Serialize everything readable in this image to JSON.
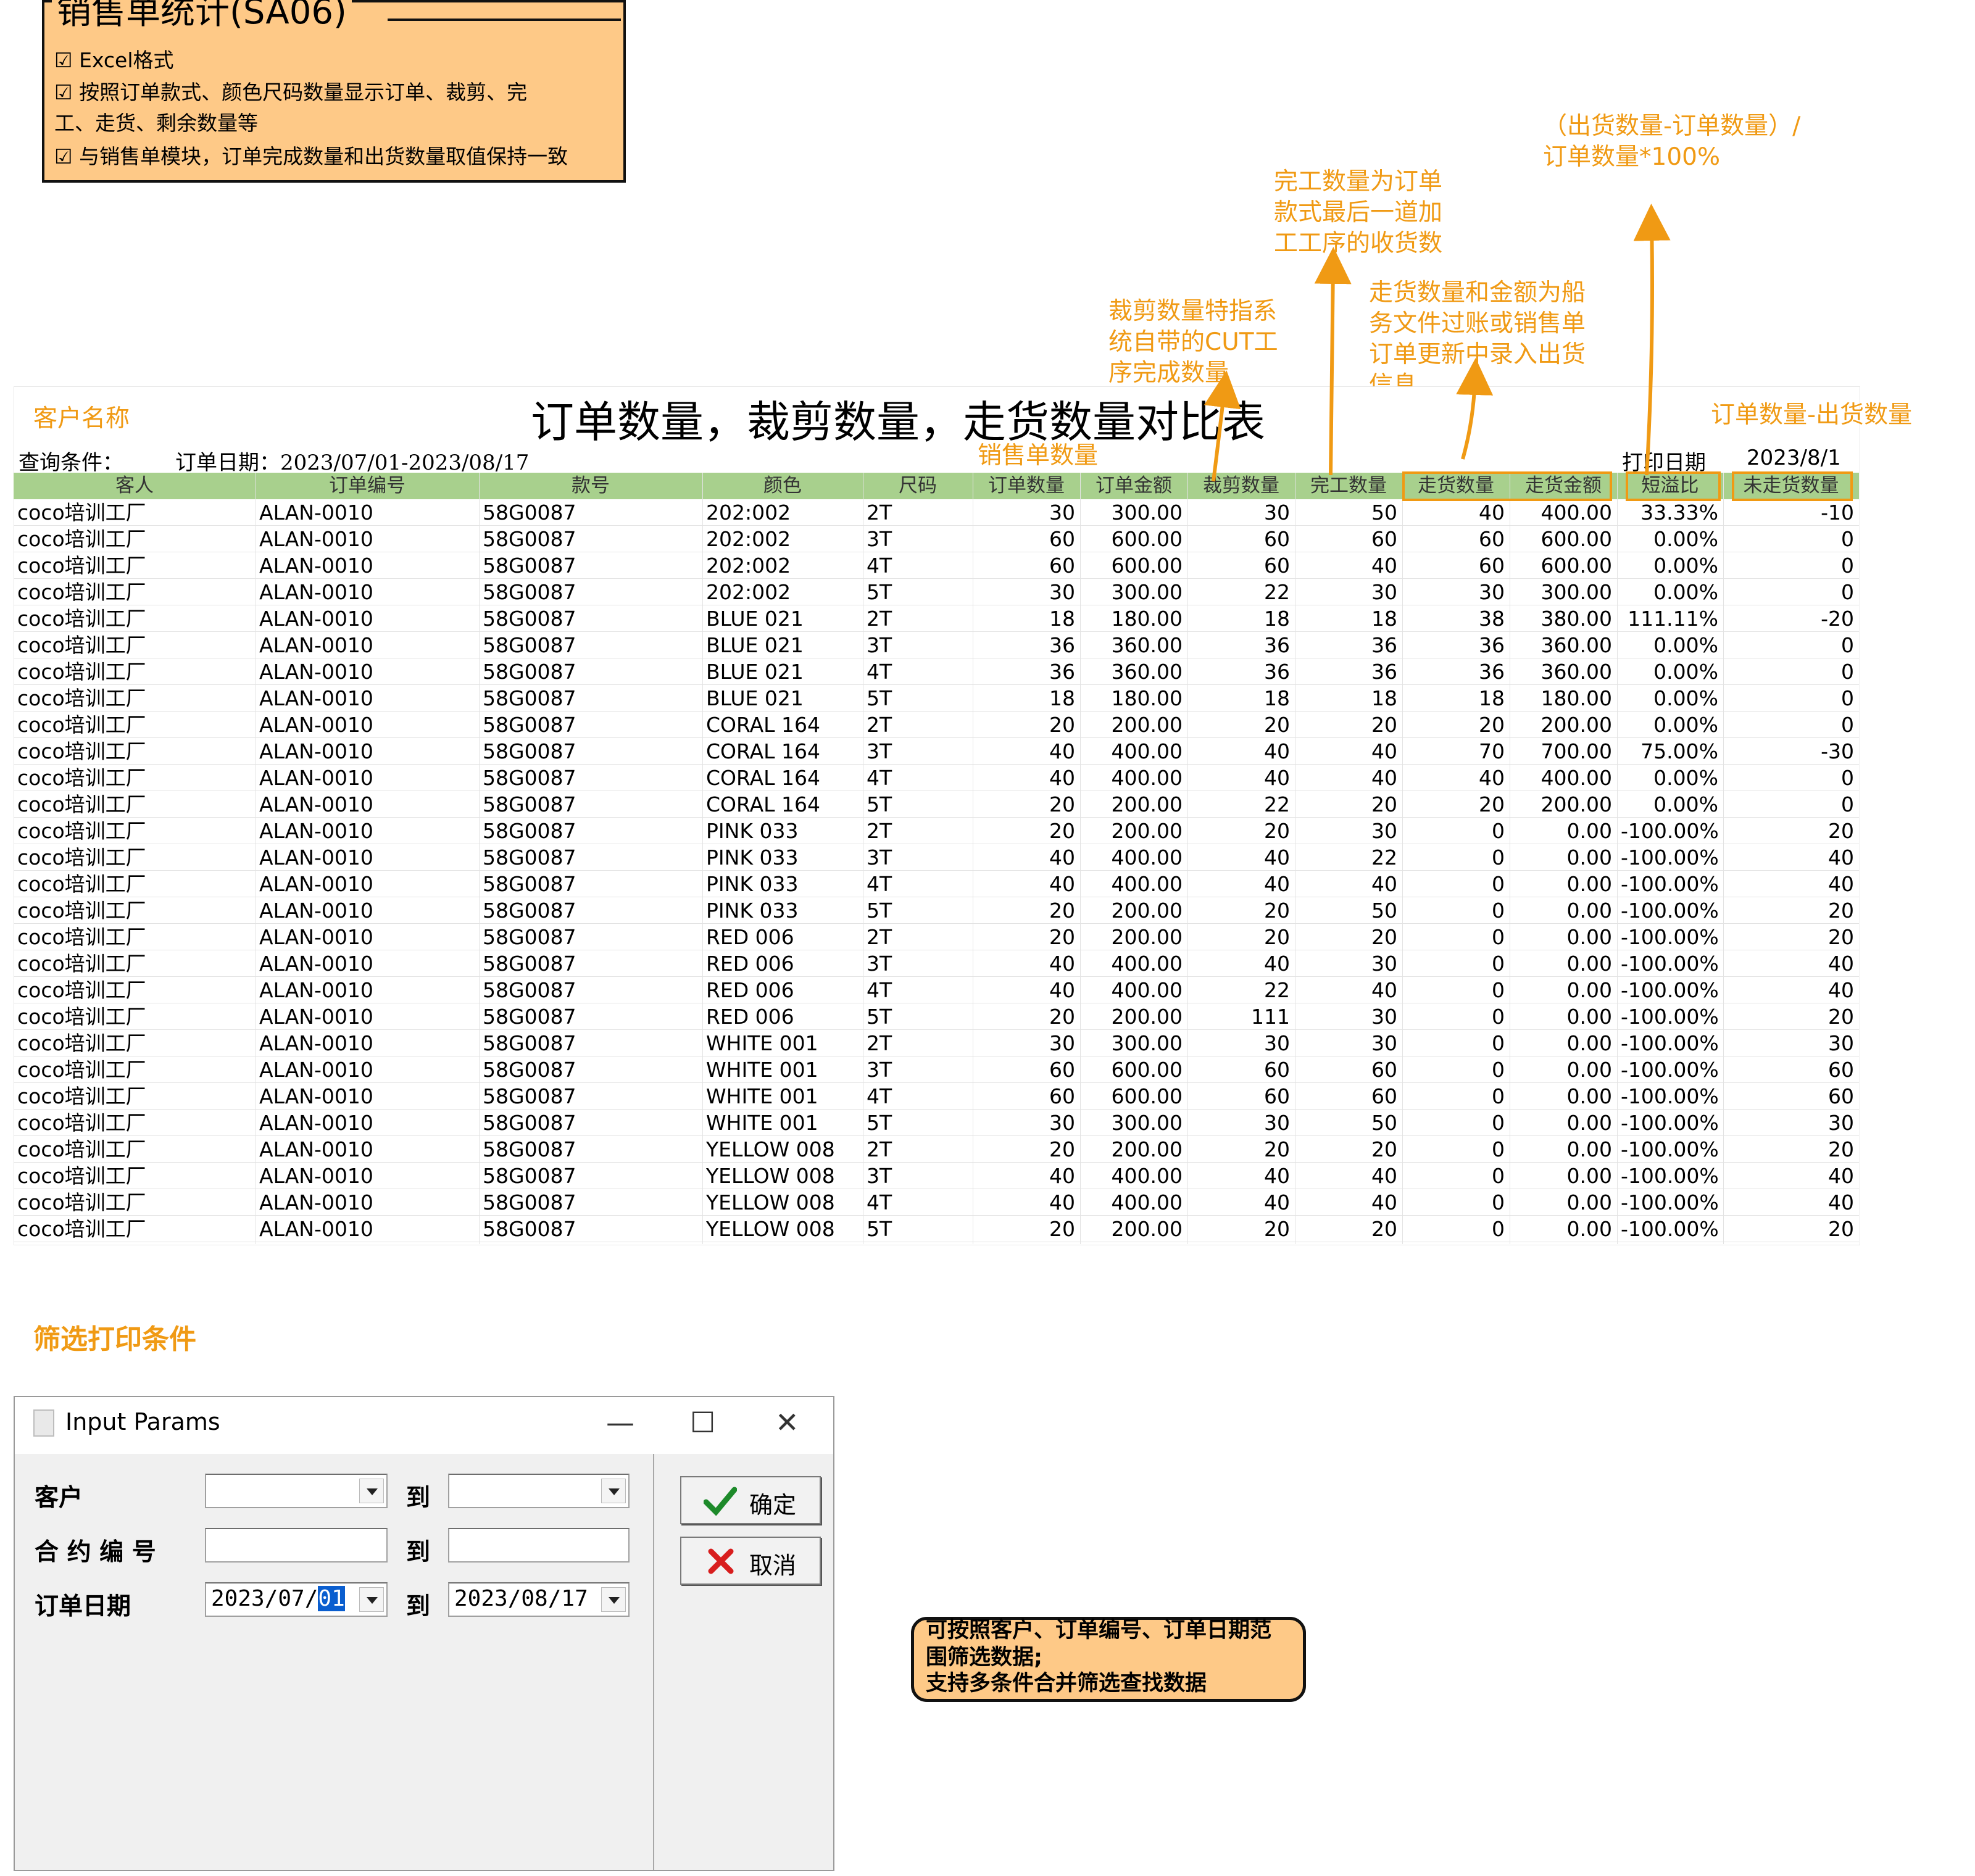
{
  "note": {
    "title": "销售单统计(SA06)",
    "lines": [
      "☑ Excel格式",
      "☑ 按照订单款式、颜色尺码数量显示订单、裁剪、完",
      "工、走货、剩余数量等",
      "☑ 与销售单模块，订单完成数量和出货数量取值保持一致"
    ]
  },
  "annotations": {
    "ratio_formula": [
      "（出货数量-订单数量）/",
      "订单数量*100%"
    ],
    "finish_qty": [
      "完工数量为订单",
      "款式最后一道加",
      "工工序的收货数"
    ],
    "ship_qty": [
      "走货数量和金额为船",
      "务文件过账或销售单",
      "订单更新中录入出货",
      "信息"
    ],
    "cut_qty": [
      "裁剪数量特指系",
      "统自带的CUT工",
      "序完成数量"
    ],
    "customer_name": "客户名称",
    "unshipped": "订单数量-出货数量",
    "sales_qty": "销售单数量",
    "filter_title": "筛选打印条件"
  },
  "report": {
    "title": "订单数量，裁剪数量，走货数量对比表",
    "condition_label": "查询条件：",
    "condition_value": "订单日期：2023/07/01-2023/08/17",
    "print_date_label": "打印日期",
    "print_date_value": "2023/8/1",
    "headers": [
      "客人",
      "订单编号",
      "款号",
      "颜色",
      "尺码",
      "订单数量",
      "订单金额",
      "裁剪数量",
      "完工数量",
      "走货数量",
      "走货金额",
      "短溢比",
      "未走货数量"
    ],
    "rows": [
      [
        "coco培训工厂",
        "ALAN-0010",
        "58G0087",
        "202:002",
        "2T",
        "30",
        "300.00",
        "30",
        "50",
        "40",
        "400.00",
        "33.33%",
        "-10"
      ],
      [
        "coco培训工厂",
        "ALAN-0010",
        "58G0087",
        "202:002",
        "3T",
        "60",
        "600.00",
        "60",
        "60",
        "60",
        "600.00",
        "0.00%",
        "0"
      ],
      [
        "coco培训工厂",
        "ALAN-0010",
        "58G0087",
        "202:002",
        "4T",
        "60",
        "600.00",
        "60",
        "40",
        "60",
        "600.00",
        "0.00%",
        "0"
      ],
      [
        "coco培训工厂",
        "ALAN-0010",
        "58G0087",
        "202:002",
        "5T",
        "30",
        "300.00",
        "22",
        "30",
        "30",
        "300.00",
        "0.00%",
        "0"
      ],
      [
        "coco培训工厂",
        "ALAN-0010",
        "58G0087",
        "BLUE 021",
        "2T",
        "18",
        "180.00",
        "18",
        "18",
        "38",
        "380.00",
        "111.11%",
        "-20"
      ],
      [
        "coco培训工厂",
        "ALAN-0010",
        "58G0087",
        "BLUE 021",
        "3T",
        "36",
        "360.00",
        "36",
        "36",
        "36",
        "360.00",
        "0.00%",
        "0"
      ],
      [
        "coco培训工厂",
        "ALAN-0010",
        "58G0087",
        "BLUE 021",
        "4T",
        "36",
        "360.00",
        "36",
        "36",
        "36",
        "360.00",
        "0.00%",
        "0"
      ],
      [
        "coco培训工厂",
        "ALAN-0010",
        "58G0087",
        "BLUE 021",
        "5T",
        "18",
        "180.00",
        "18",
        "18",
        "18",
        "180.00",
        "0.00%",
        "0"
      ],
      [
        "coco培训工厂",
        "ALAN-0010",
        "58G0087",
        "CORAL 164",
        "2T",
        "20",
        "200.00",
        "20",
        "20",
        "20",
        "200.00",
        "0.00%",
        "0"
      ],
      [
        "coco培训工厂",
        "ALAN-0010",
        "58G0087",
        "CORAL 164",
        "3T",
        "40",
        "400.00",
        "40",
        "40",
        "70",
        "700.00",
        "75.00%",
        "-30"
      ],
      [
        "coco培训工厂",
        "ALAN-0010",
        "58G0087",
        "CORAL 164",
        "4T",
        "40",
        "400.00",
        "40",
        "40",
        "40",
        "400.00",
        "0.00%",
        "0"
      ],
      [
        "coco培训工厂",
        "ALAN-0010",
        "58G0087",
        "CORAL 164",
        "5T",
        "20",
        "200.00",
        "22",
        "20",
        "20",
        "200.00",
        "0.00%",
        "0"
      ],
      [
        "coco培训工厂",
        "ALAN-0010",
        "58G0087",
        "PINK 033",
        "2T",
        "20",
        "200.00",
        "20",
        "30",
        "0",
        "0.00",
        "-100.00%",
        "20"
      ],
      [
        "coco培训工厂",
        "ALAN-0010",
        "58G0087",
        "PINK 033",
        "3T",
        "40",
        "400.00",
        "40",
        "22",
        "0",
        "0.00",
        "-100.00%",
        "40"
      ],
      [
        "coco培训工厂",
        "ALAN-0010",
        "58G0087",
        "PINK 033",
        "4T",
        "40",
        "400.00",
        "40",
        "40",
        "0",
        "0.00",
        "-100.00%",
        "40"
      ],
      [
        "coco培训工厂",
        "ALAN-0010",
        "58G0087",
        "PINK 033",
        "5T",
        "20",
        "200.00",
        "20",
        "50",
        "0",
        "0.00",
        "-100.00%",
        "20"
      ],
      [
        "coco培训工厂",
        "ALAN-0010",
        "58G0087",
        "RED 006",
        "2T",
        "20",
        "200.00",
        "20",
        "20",
        "0",
        "0.00",
        "-100.00%",
        "20"
      ],
      [
        "coco培训工厂",
        "ALAN-0010",
        "58G0087",
        "RED 006",
        "3T",
        "40",
        "400.00",
        "40",
        "30",
        "0",
        "0.00",
        "-100.00%",
        "40"
      ],
      [
        "coco培训工厂",
        "ALAN-0010",
        "58G0087",
        "RED 006",
        "4T",
        "40",
        "400.00",
        "22",
        "40",
        "0",
        "0.00",
        "-100.00%",
        "40"
      ],
      [
        "coco培训工厂",
        "ALAN-0010",
        "58G0087",
        "RED 006",
        "5T",
        "20",
        "200.00",
        "111",
        "30",
        "0",
        "0.00",
        "-100.00%",
        "20"
      ],
      [
        "coco培训工厂",
        "ALAN-0010",
        "58G0087",
        "WHITE 001",
        "2T",
        "30",
        "300.00",
        "30",
        "30",
        "0",
        "0.00",
        "-100.00%",
        "30"
      ],
      [
        "coco培训工厂",
        "ALAN-0010",
        "58G0087",
        "WHITE 001",
        "3T",
        "60",
        "600.00",
        "60",
        "60",
        "0",
        "0.00",
        "-100.00%",
        "60"
      ],
      [
        "coco培训工厂",
        "ALAN-0010",
        "58G0087",
        "WHITE 001",
        "4T",
        "60",
        "600.00",
        "60",
        "60",
        "0",
        "0.00",
        "-100.00%",
        "60"
      ],
      [
        "coco培训工厂",
        "ALAN-0010",
        "58G0087",
        "WHITE 001",
        "5T",
        "30",
        "300.00",
        "30",
        "50",
        "0",
        "0.00",
        "-100.00%",
        "30"
      ],
      [
        "coco培训工厂",
        "ALAN-0010",
        "58G0087",
        "YELLOW 008",
        "2T",
        "20",
        "200.00",
        "20",
        "20",
        "0",
        "0.00",
        "-100.00%",
        "20"
      ],
      [
        "coco培训工厂",
        "ALAN-0010",
        "58G0087",
        "YELLOW 008",
        "3T",
        "40",
        "400.00",
        "40",
        "40",
        "0",
        "0.00",
        "-100.00%",
        "40"
      ],
      [
        "coco培训工厂",
        "ALAN-0010",
        "58G0087",
        "YELLOW 008",
        "4T",
        "40",
        "400.00",
        "40",
        "40",
        "0",
        "0.00",
        "-100.00%",
        "40"
      ],
      [
        "coco培训工厂",
        "ALAN-0010",
        "58G0087",
        "YELLOW 008",
        "5T",
        "20",
        "200.00",
        "20",
        "20",
        "0",
        "0.00",
        "-100.00%",
        "20"
      ]
    ]
  },
  "dialog": {
    "title": "Input Params",
    "customer_label": "客户",
    "contract_label": "合 约 编 号",
    "date_label": "订单日期",
    "to_label": "到",
    "customer_from": "",
    "customer_to": "",
    "contract_from": "",
    "contract_to": "",
    "date_from_prefix": "2023/07/",
    "date_from_selected": "01",
    "date_to": "2023/08/17",
    "ok_label": "确定",
    "cancel_label": "取消",
    "minimize": "—",
    "maximize": "☐",
    "close": "✕"
  },
  "bubble": {
    "lines": [
      "可按照客户、订单编号、订单日期范",
      "围筛选数据;",
      "支持多条件合并筛选查找数据"
    ]
  },
  "colors": {
    "note_bg": "#FEC987",
    "annotation": "#F09A14",
    "header_bg": "#A8D08D"
  }
}
